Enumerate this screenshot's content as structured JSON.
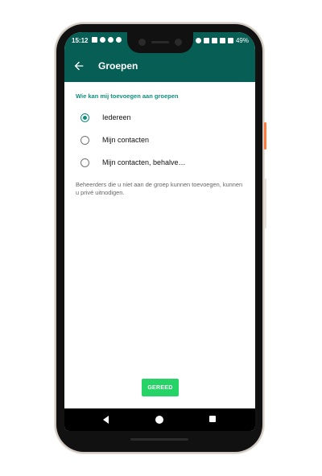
{
  "status_bar": {
    "time": "15:12",
    "battery": "49%"
  },
  "app_bar": {
    "back_icon": "arrow-left-icon",
    "title": "Groepen"
  },
  "settings": {
    "section_title": "Wie kan mij toevoegen aan groepen",
    "options": [
      {
        "label": "Iedereen",
        "selected": true
      },
      {
        "label": "Mijn contacten",
        "selected": false
      },
      {
        "label": "Mijn contacten, behalve…",
        "selected": false
      }
    ],
    "description": "Beheerders die u niet aan de groep kunnen toevoegen, kunnen u privé uitnodigen."
  },
  "done_button": {
    "label": "GEREED"
  },
  "colors": {
    "primary_dark": "#075e54",
    "accent": "#128c7e",
    "button_green": "#25d366"
  }
}
